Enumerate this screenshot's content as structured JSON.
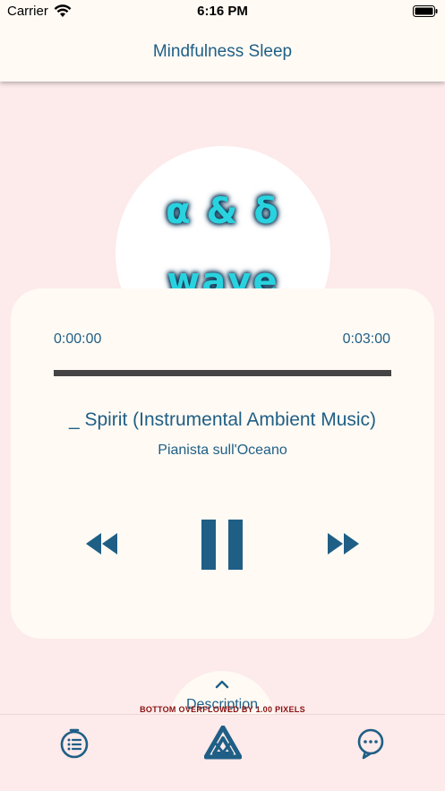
{
  "status_bar": {
    "carrier": "Carrier",
    "time": "6:16 PM"
  },
  "app_bar": {
    "title": "Mindfulness Sleep"
  },
  "artwork": {
    "line1": "α & δ",
    "line2": "wave"
  },
  "player": {
    "elapsed": "0:00:00",
    "total": "0:03:00",
    "progress_fraction": 0,
    "title": "_ Spirit (Instrumental Ambient Music)",
    "artist": "Pianista sull'Oceano"
  },
  "controls": {
    "rewind_icon": "fast-rewind-icon",
    "pause_icon": "pause-icon",
    "forward_icon": "fast-forward-icon"
  },
  "description_tab": {
    "label": "Description",
    "icon": "chevron-up-icon"
  },
  "debug": {
    "overflow_message": "BOTTOM OVERFLOWED BY 1.00 PIXELS"
  },
  "bottom_nav": {
    "items": [
      {
        "icon": "timer-list-icon"
      },
      {
        "icon": "triangle-logo-icon"
      },
      {
        "icon": "chat-bubble-icon"
      }
    ]
  },
  "colors": {
    "accent": "#1f5f86",
    "background": "#fdeaea",
    "card": "#fffaf4",
    "artwork_text": "#28d3df",
    "progress_track": "#444444"
  }
}
